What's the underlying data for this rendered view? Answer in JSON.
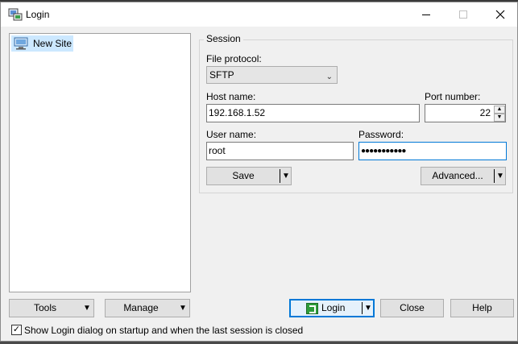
{
  "window": {
    "title": "Login"
  },
  "tree": {
    "items": [
      {
        "label": "New Site"
      }
    ]
  },
  "session": {
    "legend": "Session",
    "file_protocol_label": "File protocol:",
    "file_protocol_value": "SFTP",
    "host_label": "Host name:",
    "host_value": "192.168.1.52",
    "port_label": "Port number:",
    "port_value": "22",
    "user_label": "User name:",
    "user_value": "root",
    "password_label": "Password:",
    "password_value": "●●●●●●●●●●●",
    "save_label": "Save",
    "advanced_label": "Advanced..."
  },
  "footer": {
    "tools_label": "Tools",
    "manage_label": "Manage",
    "login_label": "Login",
    "close_label": "Close",
    "help_label": "Help",
    "show_login_label": "Show Login dialog on startup and when the last session is closed",
    "show_login_checked": true
  },
  "icons": {
    "app": "winscp-login-icon",
    "site": "computer-icon",
    "dropdown": "chevron-down-icon"
  },
  "colors": {
    "accent": "#0078d7",
    "selection": "#cce8ff"
  }
}
